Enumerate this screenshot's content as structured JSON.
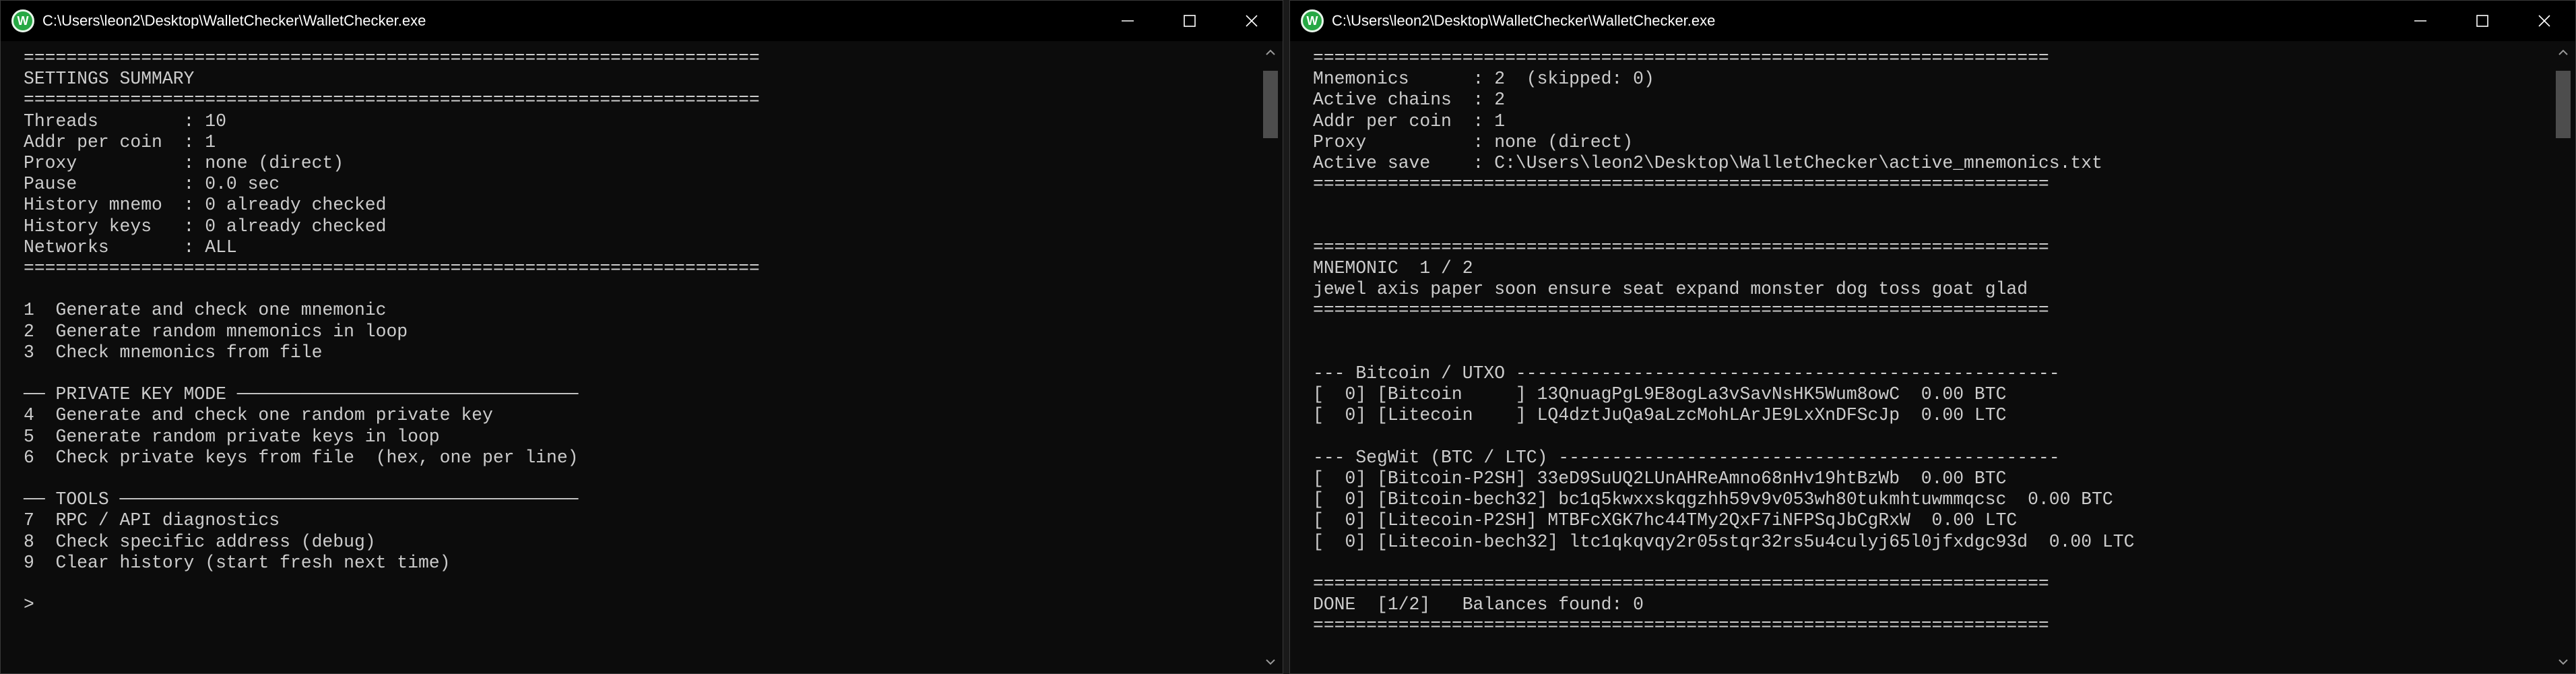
{
  "windows": [
    {
      "title": "C:\\Users\\leon2\\Desktop\\WalletChecker\\WalletChecker.exe",
      "icon": "wallet-app-icon",
      "icon_letter": "W",
      "scroll_position": 0.0,
      "lines": [
        "=====================================================================",
        "SETTINGS SUMMARY",
        "=====================================================================",
        "Threads        : 10",
        "Addr per coin  : 1",
        "Proxy          : none (direct)",
        "Pause          : 0.0 sec",
        "History mnemo  : 0 already checked",
        "History keys   : 0 already checked",
        "Networks       : ALL",
        "=====================================================================",
        "",
        "1  Generate and check one mnemonic",
        "2  Generate random mnemonics in loop",
        "3  Check mnemonics from file",
        "",
        "── PRIVATE KEY MODE ────────────────────────────────",
        "4  Generate and check one random private key",
        "5  Generate random private keys in loop",
        "6  Check private keys from file  (hex, one per line)",
        "",
        "── TOOLS ───────────────────────────────────────────",
        "7  RPC / API diagnostics",
        "8  Check specific address (debug)",
        "9  Clear history (start fresh next time)",
        "",
        ">"
      ]
    },
    {
      "title": "C:\\Users\\leon2\\Desktop\\WalletChecker\\WalletChecker.exe",
      "icon": "wallet-app-icon",
      "icon_letter": "W",
      "scroll_position": 0.0,
      "lines": [
        "=====================================================================",
        "Mnemonics      : 2  (skipped: 0)",
        "Active chains  : 2",
        "Addr per coin  : 1",
        "Proxy          : none (direct)",
        "Active save    : C:\\Users\\leon2\\Desktop\\WalletChecker\\active_mnemonics.txt",
        "=====================================================================",
        "",
        "",
        "=====================================================================",
        "MNEMONIC  1 / 2",
        "jewel axis paper soon ensure seat expand monster dog toss goat glad",
        "=====================================================================",
        "",
        "",
        "--- Bitcoin / UTXO ---------------------------------------------------",
        "[  0] [Bitcoin     ] 13QnuagPgL9E8ogLa3vSavNsHK5Wum8owC  0.00 BTC",
        "[  0] [Litecoin    ] LQ4dztJuQa9aLzcMohLArJE9LxXnDFScJp  0.00 LTC",
        "",
        "--- SegWit (BTC / LTC) -----------------------------------------------",
        "[  0] [Bitcoin-P2SH] 33eD9SuUQ2LUnAHReAmno68nHv19htBzWb  0.00 BTC",
        "[  0] [Bitcoin-bech32] bc1q5kwxxskqgzhh59v9v053wh80tukmhtuwmmqcsc  0.00 BTC",
        "[  0] [Litecoin-P2SH] MTBFcXGK7hc44TMy2QxF7iNFPSqJbCgRxW  0.00 LTC",
        "[  0] [Litecoin-bech32] ltc1qkqvqy2r05stqr32rs5u4culyj65l0jfxdgc93d  0.00 LTC",
        "",
        "=====================================================================",
        "DONE  [1/2]   Balances found: 0",
        "====================================================================="
      ]
    }
  ],
  "controls": {
    "minimize": "minimize-icon",
    "maximize": "maximize-icon",
    "close": "close-icon"
  }
}
